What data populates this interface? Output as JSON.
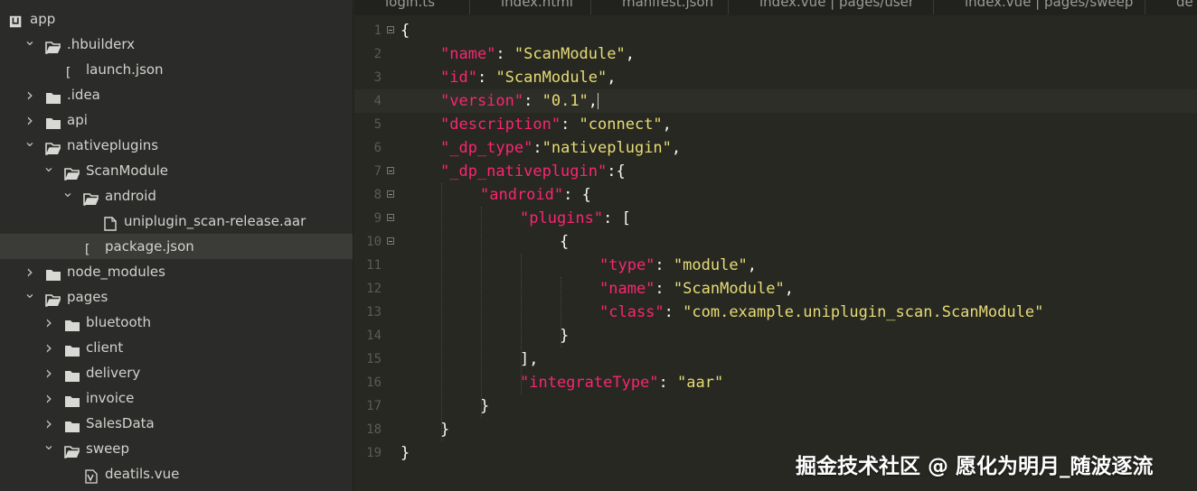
{
  "sidebar": {
    "items": [
      {
        "label": "app",
        "indent": 0,
        "icon": "project-icon",
        "chevron": ""
      },
      {
        "label": ".hbuilderx",
        "indent": 1,
        "icon": "folder-open-icon",
        "chevron": "v"
      },
      {
        "label": "launch.json",
        "indent": 2,
        "icon": "json-file-icon",
        "chevron": ""
      },
      {
        "label": ".idea",
        "indent": 1,
        "icon": "folder-icon",
        "chevron": ">"
      },
      {
        "label": "api",
        "indent": 1,
        "icon": "folder-icon",
        "chevron": ">"
      },
      {
        "label": "nativeplugins",
        "indent": 1,
        "icon": "folder-open-icon",
        "chevron": "v"
      },
      {
        "label": "ScanModule",
        "indent": 2,
        "icon": "folder-open-icon",
        "chevron": "v"
      },
      {
        "label": "android",
        "indent": 3,
        "icon": "folder-open-icon",
        "chevron": "v"
      },
      {
        "label": "uniplugin_scan-release.aar",
        "indent": 4,
        "icon": "file-icon",
        "chevron": ""
      },
      {
        "label": "package.json",
        "indent": 3,
        "icon": "json-file-icon",
        "chevron": "",
        "selected": true
      },
      {
        "label": "node_modules",
        "indent": 1,
        "icon": "folder-icon",
        "chevron": ">"
      },
      {
        "label": "pages",
        "indent": 1,
        "icon": "folder-open-icon",
        "chevron": "v"
      },
      {
        "label": "bluetooth",
        "indent": 2,
        "icon": "folder-icon",
        "chevron": ">"
      },
      {
        "label": "client",
        "indent": 2,
        "icon": "folder-icon",
        "chevron": ">"
      },
      {
        "label": "delivery",
        "indent": 2,
        "icon": "folder-icon",
        "chevron": ">"
      },
      {
        "label": "invoice",
        "indent": 2,
        "icon": "folder-icon",
        "chevron": ">"
      },
      {
        "label": "SalesData",
        "indent": 2,
        "icon": "folder-icon",
        "chevron": ">"
      },
      {
        "label": "sweep",
        "indent": 2,
        "icon": "folder-open-icon",
        "chevron": "v"
      },
      {
        "label": "deatils.vue",
        "indent": 3,
        "icon": "vue-file-icon",
        "chevron": ""
      }
    ]
  },
  "tabs": [
    {
      "label": "login.ts"
    },
    {
      "label": "index.html"
    },
    {
      "label": "manifest.json"
    },
    {
      "label": "index.vue | pages/user"
    },
    {
      "label": "index.vue | pages/sweep"
    },
    {
      "label": "de"
    }
  ],
  "editor": {
    "active_line": 4,
    "lines": [
      {
        "n": "1",
        "fold": true,
        "indent": 0,
        "tokens": [
          {
            "t": "p",
            "v": "{"
          }
        ]
      },
      {
        "n": "2",
        "fold": false,
        "indent": 1,
        "tokens": [
          {
            "t": "k",
            "v": "\"name\""
          },
          {
            "t": "p",
            "v": ": "
          },
          {
            "t": "s",
            "v": "\"ScanModule\""
          },
          {
            "t": "p",
            "v": ","
          }
        ]
      },
      {
        "n": "3",
        "fold": false,
        "indent": 1,
        "tokens": [
          {
            "t": "k",
            "v": "\"id\""
          },
          {
            "t": "p",
            "v": ": "
          },
          {
            "t": "s",
            "v": "\"ScanModule\""
          },
          {
            "t": "p",
            "v": ","
          }
        ]
      },
      {
        "n": "4",
        "fold": false,
        "indent": 1,
        "caret": true,
        "tokens": [
          {
            "t": "k",
            "v": "\"version\""
          },
          {
            "t": "p",
            "v": ": "
          },
          {
            "t": "s",
            "v": "\"0.1\""
          },
          {
            "t": "p",
            "v": ","
          }
        ]
      },
      {
        "n": "5",
        "fold": false,
        "indent": 1,
        "tokens": [
          {
            "t": "k",
            "v": "\"description\""
          },
          {
            "t": "p",
            "v": ": "
          },
          {
            "t": "s",
            "v": "\"connect\""
          },
          {
            "t": "p",
            "v": ","
          }
        ]
      },
      {
        "n": "6",
        "fold": false,
        "indent": 1,
        "tokens": [
          {
            "t": "k",
            "v": "\"_dp_type\""
          },
          {
            "t": "p",
            "v": ":"
          },
          {
            "t": "s",
            "v": "\"nativeplugin\""
          },
          {
            "t": "p",
            "v": ","
          }
        ]
      },
      {
        "n": "7",
        "fold": true,
        "indent": 1,
        "tokens": [
          {
            "t": "k",
            "v": "\"_dp_nativeplugin\""
          },
          {
            "t": "p",
            "v": ":{"
          }
        ]
      },
      {
        "n": "8",
        "fold": true,
        "indent": 2,
        "tokens": [
          {
            "t": "k",
            "v": "\"android\""
          },
          {
            "t": "p",
            "v": ": {"
          }
        ]
      },
      {
        "n": "9",
        "fold": true,
        "indent": 3,
        "tokens": [
          {
            "t": "k",
            "v": "\"plugins\""
          },
          {
            "t": "p",
            "v": ": ["
          }
        ]
      },
      {
        "n": "10",
        "fold": true,
        "indent": 4,
        "tokens": [
          {
            "t": "p",
            "v": "{"
          }
        ]
      },
      {
        "n": "11",
        "fold": false,
        "indent": 5,
        "tokens": [
          {
            "t": "k",
            "v": "\"type\""
          },
          {
            "t": "p",
            "v": ": "
          },
          {
            "t": "s",
            "v": "\"module\""
          },
          {
            "t": "p",
            "v": ","
          }
        ]
      },
      {
        "n": "12",
        "fold": false,
        "indent": 5,
        "tokens": [
          {
            "t": "k",
            "v": "\"name\""
          },
          {
            "t": "p",
            "v": ": "
          },
          {
            "t": "s",
            "v": "\"ScanModule\""
          },
          {
            "t": "p",
            "v": ","
          }
        ]
      },
      {
        "n": "13",
        "fold": false,
        "indent": 5,
        "tokens": [
          {
            "t": "k",
            "v": "\"class\""
          },
          {
            "t": "p",
            "v": ": "
          },
          {
            "t": "s",
            "v": "\"com.example.uniplugin_scan.ScanModule\""
          }
        ]
      },
      {
        "n": "14",
        "fold": false,
        "indent": 4,
        "tokens": [
          {
            "t": "p",
            "v": "}"
          }
        ]
      },
      {
        "n": "15",
        "fold": false,
        "indent": 3,
        "tokens": [
          {
            "t": "p",
            "v": "],"
          }
        ]
      },
      {
        "n": "16",
        "fold": false,
        "indent": 3,
        "tokens": [
          {
            "t": "k",
            "v": "\"integrateType\""
          },
          {
            "t": "p",
            "v": ": "
          },
          {
            "t": "s",
            "v": "\"aar\""
          }
        ]
      },
      {
        "n": "17",
        "fold": false,
        "indent": 2,
        "tokens": [
          {
            "t": "p",
            "v": "}"
          }
        ]
      },
      {
        "n": "18",
        "fold": false,
        "indent": 1,
        "tokens": [
          {
            "t": "p",
            "v": "}"
          }
        ]
      },
      {
        "n": "19",
        "fold": false,
        "indent": 0,
        "tokens": [
          {
            "t": "p",
            "v": "}"
          }
        ]
      }
    ]
  },
  "watermark": "掘金技术社区 @ 愿化为明月_随波逐流",
  "colors": {
    "editor_bg": "#272822",
    "sidebar_bg": "#2b2b29",
    "key": "#f92672",
    "string": "#e6db74",
    "punct": "#f8f8f2",
    "line_number": "#5a5b55"
  }
}
